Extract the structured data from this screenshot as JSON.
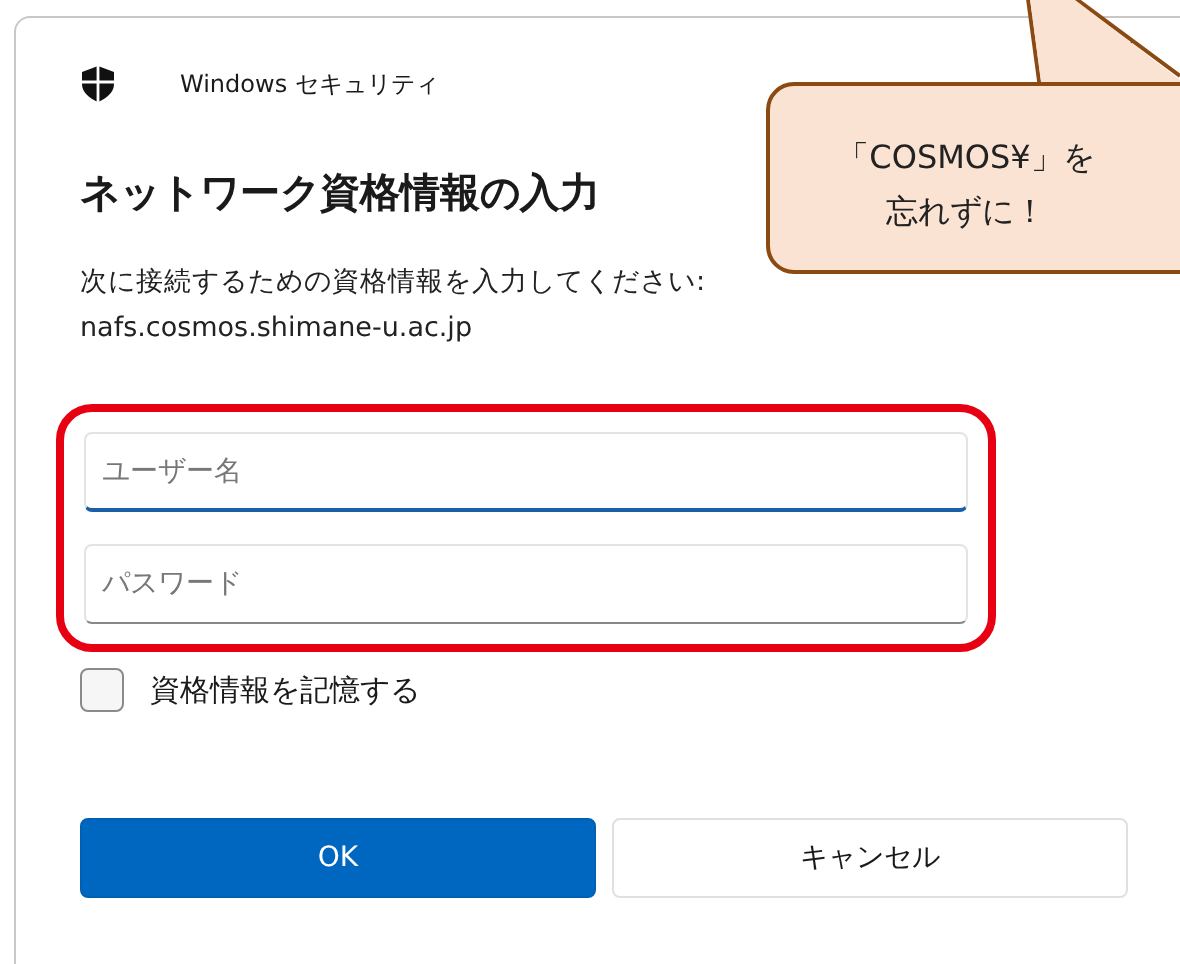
{
  "window": {
    "title": "Windows セキュリティ"
  },
  "heading": "ネットワーク資格情報の入力",
  "description": "次に接続するための資格情報を入力してください:",
  "server": "nafs.cosmos.shimane-u.ac.jp",
  "fields": [
    {
      "placeholder": "ユーザー名",
      "focused": true
    },
    {
      "placeholder": "パスワード",
      "focused": false
    }
  ],
  "remember": {
    "label": "資格情報を記憶する",
    "checked": false
  },
  "buttons": [
    {
      "label": "OK",
      "kind": "primary"
    },
    {
      "label": "キャンセル",
      "kind": "secondary"
    }
  ],
  "callout": {
    "lines": [
      "「COSMOS¥」を",
      "忘れずに！"
    ]
  }
}
